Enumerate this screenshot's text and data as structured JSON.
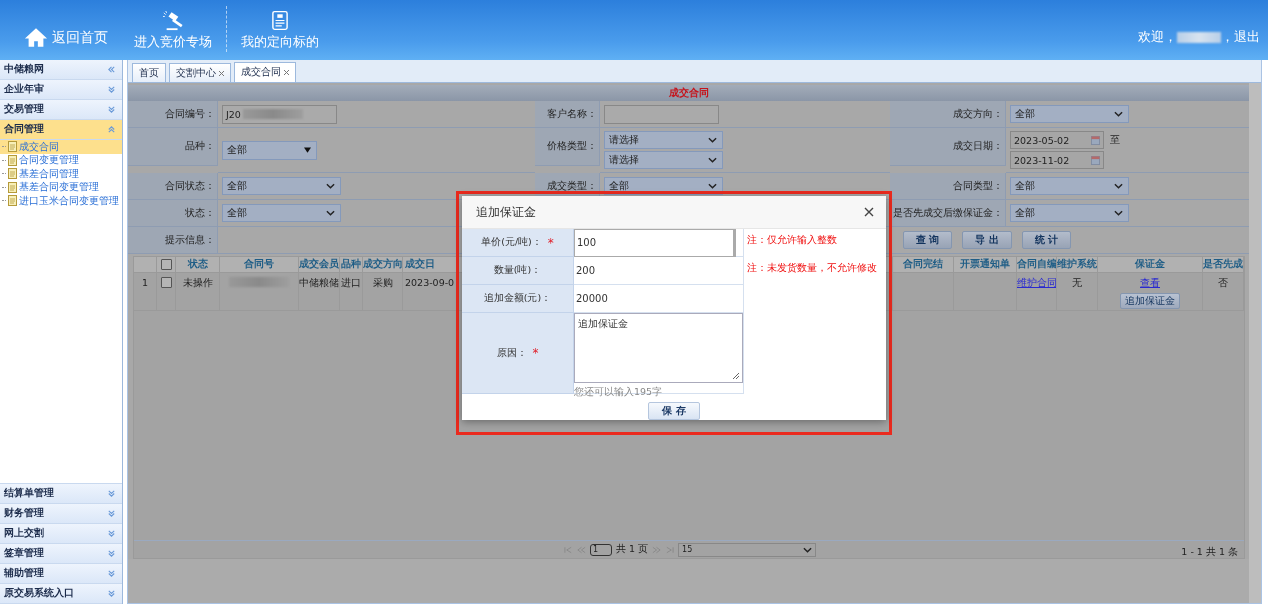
{
  "header": {
    "nav": [
      {
        "label": "返回首页"
      },
      {
        "label": "进入竞价专场"
      },
      {
        "label": "我的定向标的"
      }
    ],
    "greeting": "欢迎，",
    "separator": "，",
    "logout": "退出"
  },
  "sidebar": {
    "title": "中储粮网",
    "groups_top": [
      {
        "label": "企业年审",
        "expanded": false
      },
      {
        "label": "交易管理",
        "expanded": false
      },
      {
        "label": "合同管理",
        "expanded": true,
        "children": [
          {
            "label": "成交合同",
            "selected": true
          },
          {
            "label": "合同变更管理",
            "selected": false
          },
          {
            "label": "基差合同管理",
            "selected": false
          },
          {
            "label": "基差合同变更管理",
            "selected": false
          },
          {
            "label": "进口玉米合同变更管理",
            "selected": false
          }
        ]
      }
    ],
    "groups_bottom": [
      {
        "label": "结算单管理",
        "expanded": false
      },
      {
        "label": "财务管理",
        "expanded": false
      },
      {
        "label": "网上交割",
        "expanded": false
      },
      {
        "label": "签章管理",
        "expanded": false
      },
      {
        "label": "辅助管理",
        "expanded": false
      },
      {
        "label": "原交易系统入口",
        "expanded": false
      }
    ]
  },
  "tabs": [
    {
      "label": "首页",
      "closable": false,
      "selected": false
    },
    {
      "label": "交割中心",
      "closable": true,
      "selected": false
    },
    {
      "label": "成交合同",
      "closable": true,
      "selected": true
    }
  ],
  "form": {
    "title": "成交合同",
    "rows": [
      [
        {
          "label": "合同编号：",
          "fields": [
            {
              "kind": "input",
              "value": "J20",
              "redacted": true
            }
          ]
        },
        {
          "label": "客户名称：",
          "fields": [
            {
              "kind": "input"
            }
          ]
        },
        {
          "label": "成交方向：",
          "fields": [
            {
              "kind": "select",
              "value": "全部"
            }
          ]
        }
      ],
      [
        {
          "label": "品种：",
          "fields": [
            {
              "kind": "select-classic",
              "value": "全部"
            }
          ]
        },
        {
          "label": "价格类型：",
          "fields": [
            {
              "kind": "select",
              "value": "请选择"
            },
            {
              "kind": "select",
              "value": "请选择"
            }
          ]
        },
        {
          "label": "成交日期：",
          "fields": [
            {
              "kind": "date",
              "value": "2023-05-02",
              "suffix": "至"
            },
            {
              "kind": "date",
              "value": "2023-11-02"
            }
          ]
        }
      ],
      [
        {
          "label": "合同状态：",
          "fields": [
            {
              "kind": "select",
              "value": "全部"
            }
          ]
        },
        {
          "label": "成交类型：",
          "fields": [
            {
              "kind": "select",
              "value": "全部"
            }
          ]
        },
        {
          "label": "合同类型：",
          "fields": [
            {
              "kind": "select",
              "value": "全部"
            }
          ]
        }
      ],
      [
        {
          "label": "状态：",
          "fields": [
            {
              "kind": "select",
              "value": "全部"
            }
          ]
        },
        "",
        {
          "label": "是否先成交后缴保证金：",
          "fields": [
            {
              "kind": "select",
              "value": "全部"
            }
          ]
        }
      ]
    ],
    "hint_label": "提示信息：",
    "buttons": [
      "查 询",
      "导 出",
      "统 计"
    ]
  },
  "table": {
    "columns": [
      {
        "kind": "rownum"
      },
      {
        "kind": "checkbox",
        "checked": false
      },
      {
        "label": "状态"
      },
      {
        "label": "合同号"
      },
      {
        "label": "成交会员"
      },
      {
        "label": "品种"
      },
      {
        "label": "成交方向"
      },
      {
        "label": "成交日"
      },
      {
        "kind": "spacer"
      },
      {
        "label": "合同完结"
      },
      {
        "label": "开票通知单"
      },
      {
        "label": "合同自编"
      },
      {
        "label": "维护系统"
      },
      {
        "label": "保证金"
      },
      {
        "label": "是否先成"
      }
    ],
    "rows": [
      {
        "cells": [
          {
            "kind": "rownum",
            "text": "1"
          },
          {
            "kind": "checkbox",
            "checked": false
          },
          {
            "text": "未操作"
          },
          {
            "kind": "redacted"
          },
          {
            "text": "中储粮储"
          },
          {
            "text": "进口"
          },
          {
            "text": "采购"
          },
          {
            "text": "2023-09-0"
          },
          {
            "kind": "empty"
          },
          {
            "kind": "empty"
          },
          {
            "kind": "empty"
          },
          {
            "kind": "link",
            "text": "维护合同"
          },
          {
            "text": "无"
          },
          {
            "kind": "link-button",
            "text": "查看",
            "button": "追加保证金"
          },
          {
            "text": "否"
          }
        ]
      }
    ]
  },
  "pager": {
    "page_input": "1",
    "page_total": "共  1 页",
    "page_size": "15",
    "range": "1 - 1   共 1 条"
  },
  "dialog": {
    "title": "追加保证金",
    "required_mark": "*",
    "rows": [
      {
        "label": "单价(元/吨)：",
        "required": true,
        "kind": "input",
        "value": "100",
        "note": "注：仅允许输入整数"
      },
      {
        "label": "数量(吨)：",
        "required": false,
        "kind": "text",
        "value": "200",
        "note": "注：未发货数量，不允许修改"
      },
      {
        "label": "追加金额(元)：",
        "required": false,
        "kind": "text",
        "value": "20000"
      },
      {
        "label": "原因：",
        "required": true,
        "kind": "textarea",
        "value": "追加保证金",
        "counter": "您还可以输入195字"
      }
    ],
    "save": "保 存"
  }
}
